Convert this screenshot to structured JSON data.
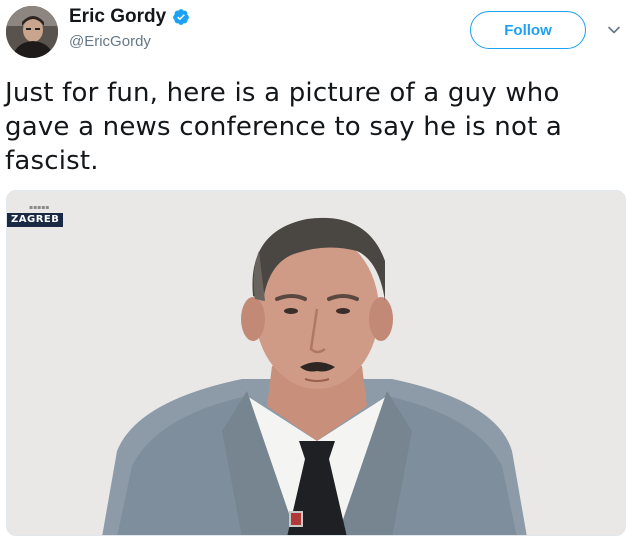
{
  "author": {
    "display_name": "Eric Gordy",
    "handle": "@EricGordy",
    "verified": true
  },
  "actions": {
    "follow_label": "Follow",
    "menu_icon": "chevron-down-icon"
  },
  "tweet": {
    "text": "Just for fun, here is a picture of a guy who gave a news conference to say he is not a fascist."
  },
  "media": {
    "channel_label": "ZAGREB"
  },
  "colors": {
    "accent": "#1da1f2",
    "secondary_text": "#657786",
    "primary_text": "#14171a"
  }
}
